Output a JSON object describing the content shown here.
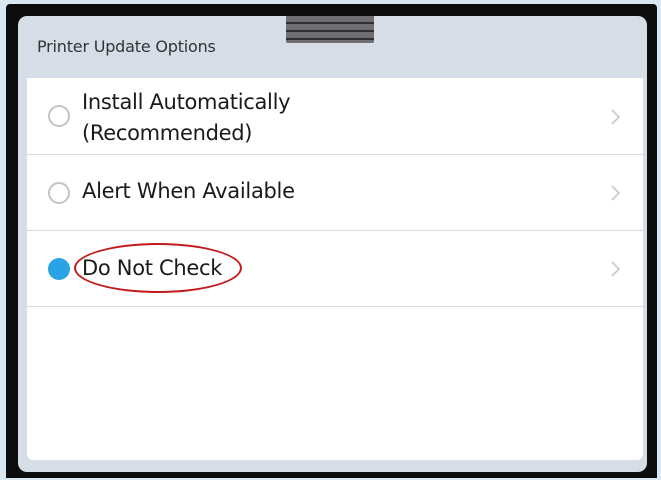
{
  "header": {
    "title": "Printer Update Options"
  },
  "options": [
    {
      "line1": "Install Automatically",
      "line2": "(Recommended)",
      "selected": false
    },
    {
      "line1": "Alert When Available",
      "selected": false
    },
    {
      "line1": "Do Not Check",
      "selected": true
    }
  ],
  "colors": {
    "selected_radio": "#2aa3e6",
    "callout": "#c21a1a",
    "header_bg": "#d6dde7",
    "panel_bg": "#ffffff"
  },
  "icons": {
    "chevron": "chevron-right-icon",
    "radio_empty": "radio-unselected-icon",
    "radio_filled": "radio-selected-icon"
  }
}
